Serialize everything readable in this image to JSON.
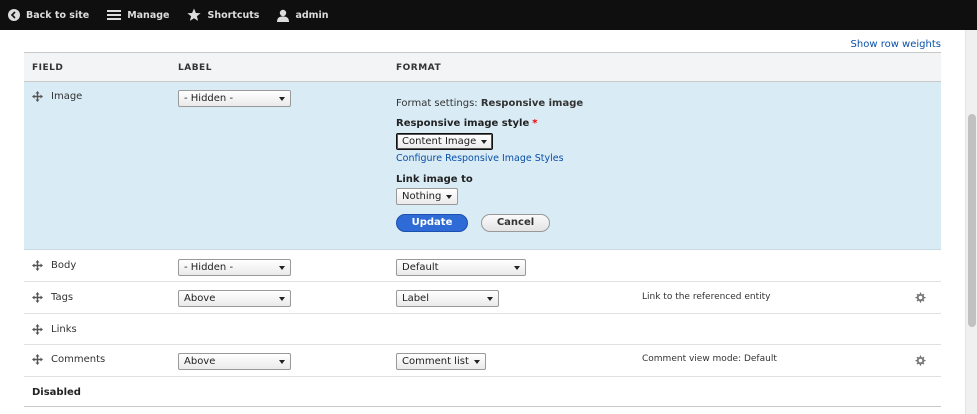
{
  "toolbar": {
    "back_label": "Back to site",
    "manage_label": "Manage",
    "shortcuts_label": "Shortcuts",
    "user_label": "admin"
  },
  "show_row_weights": "Show row weights",
  "table": {
    "headers": {
      "field": "FIELD",
      "label": "LABEL",
      "format": "FORMAT"
    },
    "image": {
      "name": "Image",
      "label_value": "- Hidden -",
      "format_settings_prefix": "Format settings:",
      "format_settings_name": "Responsive image",
      "style_label": "Responsive image style",
      "required_mark": "*",
      "style_value": "Content Image",
      "configure_link": "Configure Responsive Image Styles",
      "link_to_label": "Link image to",
      "link_to_value": "Nothing",
      "update_label": "Update",
      "cancel_label": "Cancel"
    },
    "body": {
      "name": "Body",
      "label_value": "- Hidden -",
      "format_value": "Default"
    },
    "tags": {
      "name": "Tags",
      "label_value": "Above",
      "format_value": "Label",
      "summary": "Link to the referenced entity"
    },
    "links": {
      "name": "Links"
    },
    "comments": {
      "name": "Comments",
      "label_value": "Above",
      "format_value": "Comment list",
      "summary": "Comment view mode: Default"
    },
    "disabled_label": "Disabled"
  }
}
